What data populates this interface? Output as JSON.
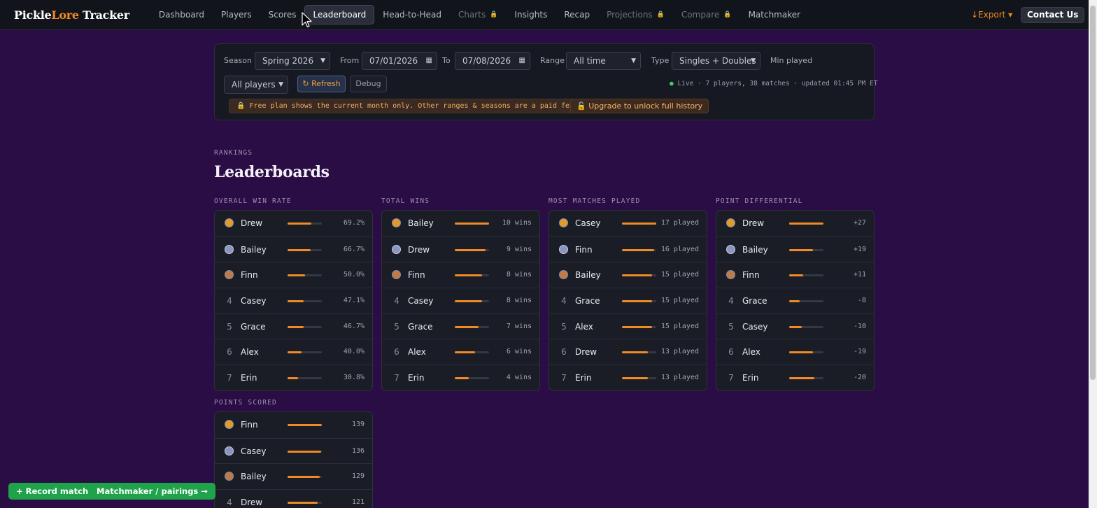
{
  "app": {
    "brand_a": "Pickle",
    "brand_b": "Lore",
    "brand_c": " Tracker"
  },
  "nav": [
    {
      "label": "Dashboard",
      "active": false,
      "locked": false
    },
    {
      "label": "Players",
      "active": false,
      "locked": false
    },
    {
      "label": "Scores",
      "active": false,
      "locked": false
    },
    {
      "label": "Leaderboard",
      "active": true,
      "locked": false
    },
    {
      "label": "Head-to-Head",
      "active": false,
      "locked": false
    },
    {
      "label": "Charts",
      "active": false,
      "locked": true
    },
    {
      "label": "Insights",
      "active": false,
      "locked": false
    },
    {
      "label": "Recap",
      "active": false,
      "locked": false
    },
    {
      "label": "Projections",
      "active": false,
      "locked": true
    },
    {
      "label": "Compare",
      "active": false,
      "locked": true
    },
    {
      "label": "Matchmaker",
      "active": false,
      "locked": false
    }
  ],
  "header": {
    "export_label": "↓Export ▾",
    "contact_label": "Contact Us"
  },
  "filters": {
    "season_label": "Season",
    "season_value": "Spring 2026",
    "from_label": "From",
    "from_value": "07/01/2026",
    "to_label": "To",
    "to_value": "07/08/2026",
    "range_label": "Range",
    "range_value": "All time",
    "type_label": "Type",
    "type_value": "Singles + Doubles",
    "min_played_label": "Min played",
    "players_value": "All players",
    "refresh_label": "↻ Refresh",
    "debug_label": "Debug",
    "status_dot": "●",
    "status_text": " Live · 7 players, 38 matches · updated 01:45 PM ET",
    "notice": "🔒 Free plan shows the current month only. Other ranges & seasons are a paid feature.",
    "upgrade_label": "🔓 Upgrade to unlock full history"
  },
  "page": {
    "eyebrow": "RANKINGS",
    "title": "Leaderboards"
  },
  "boards": [
    {
      "title": "OVERALL WIN RATE",
      "rows": [
        {
          "rank": "1",
          "name": "Drew",
          "value": "69.2%",
          "fill": 0.69
        },
        {
          "rank": "2",
          "name": "Bailey",
          "value": "66.7%",
          "fill": 0.67
        },
        {
          "rank": "3",
          "name": "Finn",
          "value": "50.0%",
          "fill": 0.5
        },
        {
          "rank": "4",
          "name": "Casey",
          "value": "47.1%",
          "fill": 0.47
        },
        {
          "rank": "5",
          "name": "Grace",
          "value": "46.7%",
          "fill": 0.47
        },
        {
          "rank": "6",
          "name": "Alex",
          "value": "40.0%",
          "fill": 0.4
        },
        {
          "rank": "7",
          "name": "Erin",
          "value": "30.8%",
          "fill": 0.31
        }
      ]
    },
    {
      "title": "TOTAL WINS",
      "rows": [
        {
          "rank": "1",
          "name": "Bailey",
          "value": "10 wins",
          "fill": 1.0
        },
        {
          "rank": "2",
          "name": "Drew",
          "value": "9 wins",
          "fill": 0.9
        },
        {
          "rank": "3",
          "name": "Finn",
          "value": "8 wins",
          "fill": 0.8
        },
        {
          "rank": "4",
          "name": "Casey",
          "value": "8 wins",
          "fill": 0.8
        },
        {
          "rank": "5",
          "name": "Grace",
          "value": "7 wins",
          "fill": 0.7
        },
        {
          "rank": "6",
          "name": "Alex",
          "value": "6 wins",
          "fill": 0.6
        },
        {
          "rank": "7",
          "name": "Erin",
          "value": "4 wins",
          "fill": 0.4
        }
      ]
    },
    {
      "title": "MOST MATCHES PLAYED",
      "rows": [
        {
          "rank": "1",
          "name": "Casey",
          "value": "17 played",
          "fill": 1.0
        },
        {
          "rank": "2",
          "name": "Finn",
          "value": "16 played",
          "fill": 0.94
        },
        {
          "rank": "3",
          "name": "Bailey",
          "value": "15 played",
          "fill": 0.88
        },
        {
          "rank": "4",
          "name": "Grace",
          "value": "15 played",
          "fill": 0.88
        },
        {
          "rank": "5",
          "name": "Alex",
          "value": "15 played",
          "fill": 0.88
        },
        {
          "rank": "6",
          "name": "Drew",
          "value": "13 played",
          "fill": 0.76
        },
        {
          "rank": "7",
          "name": "Erin",
          "value": "13 played",
          "fill": 0.76
        }
      ]
    },
    {
      "title": "POINT DIFFERENTIAL",
      "rows": [
        {
          "rank": "1",
          "name": "Drew",
          "value": "+27",
          "fill": 1.0
        },
        {
          "rank": "2",
          "name": "Bailey",
          "value": "+19",
          "fill": 0.7
        },
        {
          "rank": "3",
          "name": "Finn",
          "value": "+11",
          "fill": 0.41
        },
        {
          "rank": "4",
          "name": "Grace",
          "value": "-8",
          "fill": 0.3
        },
        {
          "rank": "5",
          "name": "Casey",
          "value": "-10",
          "fill": 0.37
        },
        {
          "rank": "6",
          "name": "Alex",
          "value": "-19",
          "fill": 0.7
        },
        {
          "rank": "7",
          "name": "Erin",
          "value": "-20",
          "fill": 0.74
        }
      ]
    },
    {
      "title": "POINTS SCORED",
      "rows": [
        {
          "rank": "1",
          "name": "Finn",
          "value": "139",
          "fill": 1.0
        },
        {
          "rank": "2",
          "name": "Casey",
          "value": "136",
          "fill": 0.98
        },
        {
          "rank": "3",
          "name": "Bailey",
          "value": "129",
          "fill": 0.93
        },
        {
          "rank": "4",
          "name": "Drew",
          "value": "121",
          "fill": 0.87
        }
      ]
    }
  ],
  "footer": {
    "record_label": "+ Record match",
    "matchmaker_label": "Matchmaker / pairings →"
  },
  "colors": {
    "background": "#2b0d45",
    "accent": "#f08a24",
    "success": "#1fa34a"
  }
}
